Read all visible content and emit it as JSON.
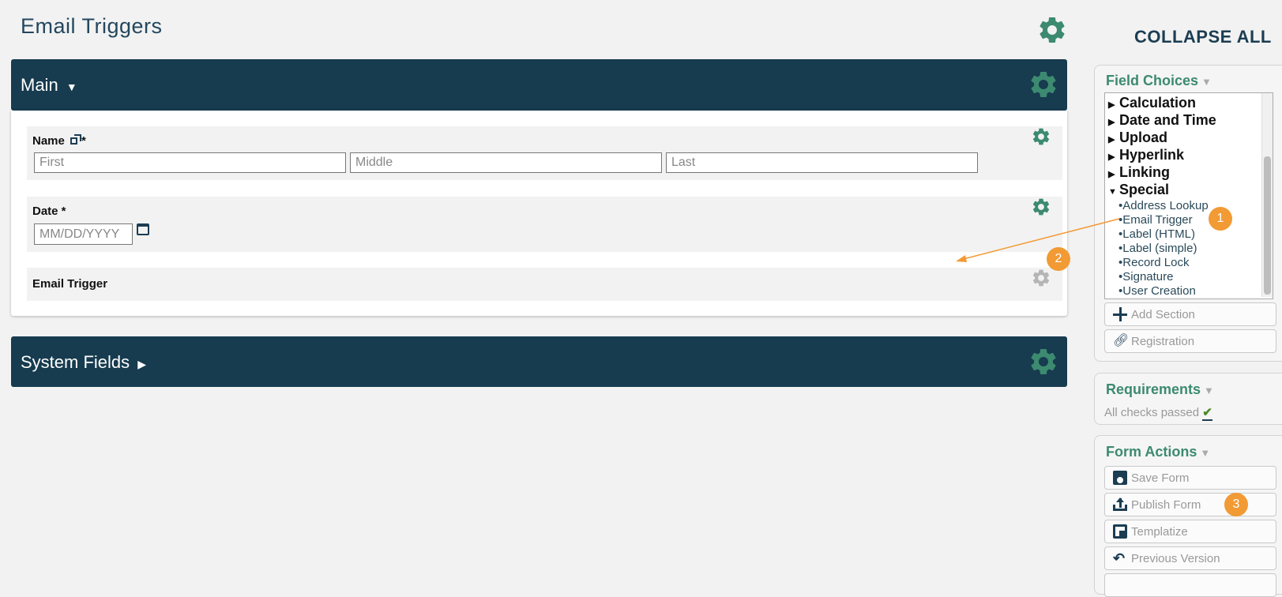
{
  "header": {
    "title": "Email Triggers",
    "collapse_all": "COLLAPSE ALL"
  },
  "sections": {
    "main": {
      "title": "Main",
      "fields": {
        "name": {
          "label": "Name",
          "required_mark": "*",
          "placeholders": {
            "first": "First",
            "middle": "Middle",
            "last": "Last"
          }
        },
        "date": {
          "label": "Date *",
          "placeholder": "MM/DD/YYYY"
        },
        "email_trigger": {
          "label": "Email Trigger"
        }
      }
    },
    "system": {
      "title": "System Fields"
    }
  },
  "field_choices": {
    "title": "Field Choices",
    "categories": [
      "Calculation",
      "Date and Time",
      "Upload",
      "Hyperlink",
      "Linking",
      "Special"
    ],
    "special_items": [
      "Address Lookup",
      "Email Trigger",
      "Label (HTML)",
      "Label (simple)",
      "Record Lock",
      "Signature",
      "User Creation"
    ],
    "buttons": {
      "add_section": "Add Section",
      "registration": "Registration"
    }
  },
  "requirements": {
    "title": "Requirements",
    "status": "All checks passed"
  },
  "form_actions": {
    "title": "Form Actions",
    "buttons": [
      "Save Form",
      "Publish Form",
      "Templatize",
      "Previous Version"
    ]
  },
  "annotations": {
    "badges": [
      "1",
      "2",
      "3"
    ]
  },
  "colors": {
    "navy": "#173b4f",
    "gear_green": "#3c8a70",
    "badge_orange": "#f29a33"
  }
}
